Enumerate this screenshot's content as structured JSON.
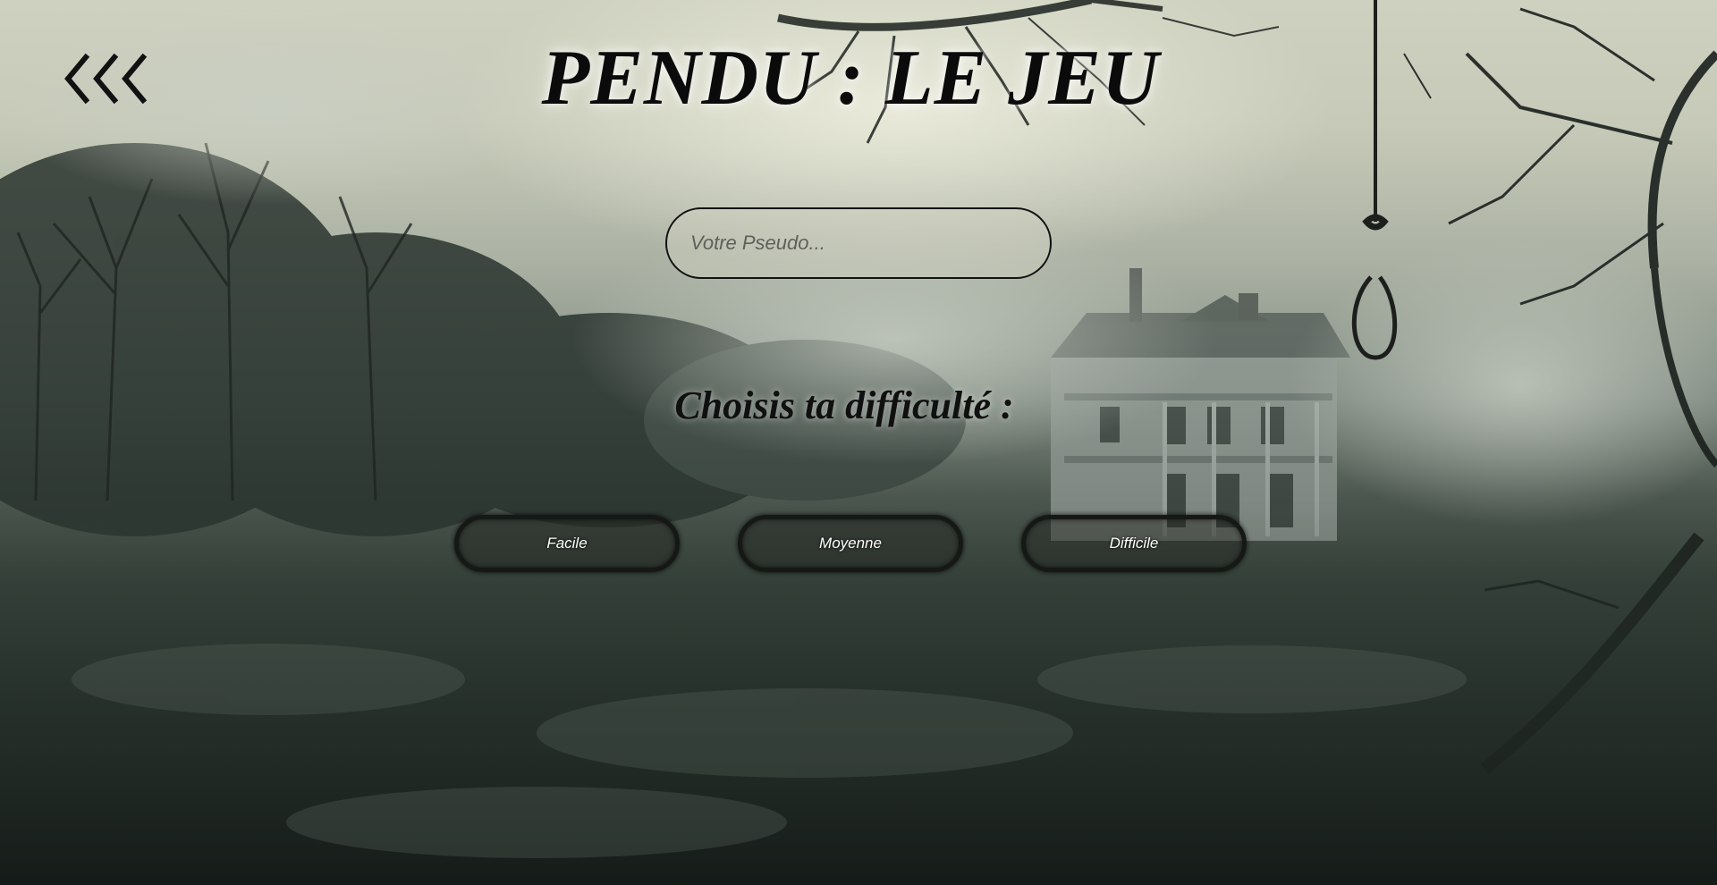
{
  "header": {
    "back_icon": "triple-chevron-left-icon",
    "title": "PENDU : LE JEU"
  },
  "form": {
    "pseudo_placeholder": "Votre Pseudo...",
    "pseudo_value": ""
  },
  "difficulty": {
    "prompt": "Choisis ta difficulté :",
    "options": [
      {
        "label": "Facile"
      },
      {
        "label": "Moyenne"
      },
      {
        "label": "Difficile"
      }
    ]
  },
  "background": {
    "description_icons": [
      "bare-trees-icon",
      "haunted-house-icon",
      "noose-icon",
      "fog"
    ],
    "palette": {
      "sky": "#cfd1c0",
      "fog": "#8a958b",
      "ground": "#1d2622",
      "ink": "#0b0b0b"
    }
  }
}
